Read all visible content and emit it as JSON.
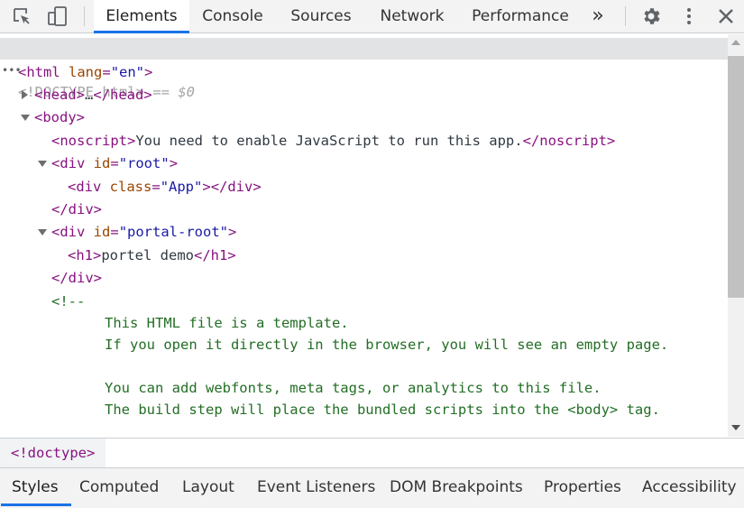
{
  "toolbar": {
    "tabs": [
      {
        "label": "Elements",
        "active": true
      },
      {
        "label": "Console",
        "active": false
      },
      {
        "label": "Sources",
        "active": false
      },
      {
        "label": "Network",
        "active": false
      },
      {
        "label": "Performance",
        "active": false
      }
    ],
    "more_tabs_glyph": "»",
    "icons": {
      "inspect": "inspect-element-icon",
      "device": "device-toolbar-icon",
      "settings": "settings-gear-icon",
      "menu": "kebab-menu-icon",
      "close": "close-icon"
    }
  },
  "tree": {
    "selected_dots": "•••",
    "doctype": "<!DOCTYPE html>",
    "selected_marker": "== $0",
    "html_open_tag": "<html",
    "html_attr": "lang",
    "html_val": "\"en\"",
    "html_close": ">",
    "head": "<head>",
    "head_ellipsis": "…",
    "head_close": "</head>",
    "body": "<body>",
    "noscript_open": "<noscript>",
    "noscript_text": "You need to enable JavaScript to run this app.",
    "noscript_close": "</noscript>",
    "div_open": "<div",
    "id_attr": "id",
    "root_val": "\"root\"",
    "gt": ">",
    "class_attr": "class",
    "app_val": "\"App\"",
    "div_close_inline": "></div>",
    "div_close": "</div>",
    "portal_val": "\"portal-root\"",
    "h1_open": "<h1>",
    "h1_text": "portel demo",
    "h1_close": "</h1>",
    "comment_open": "<!--",
    "comment_lines": [
      "This HTML file is a template.",
      "If you open it directly in the browser, you will see an empty page.",
      "",
      "You can add webfonts, meta tags, or analytics to this file.",
      "The build step will place the bundled scripts into the <body> tag."
    ]
  },
  "breadcrumb": {
    "label": "<!doctype>"
  },
  "bottom_tabs": [
    {
      "label": "Styles",
      "active": true
    },
    {
      "label": "Computed",
      "active": false
    },
    {
      "label": "Layout",
      "active": false
    },
    {
      "label": "Event Listeners",
      "active": false
    },
    {
      "label": "DOM Breakpoints",
      "active": false
    },
    {
      "label": "Properties",
      "active": false
    },
    {
      "label": "Accessibility",
      "active": false
    }
  ],
  "colors": {
    "tag": "#881280",
    "attribute": "#994500",
    "value": "#1a1aa6",
    "comment": "#236e25",
    "accent": "#1a73e8"
  }
}
